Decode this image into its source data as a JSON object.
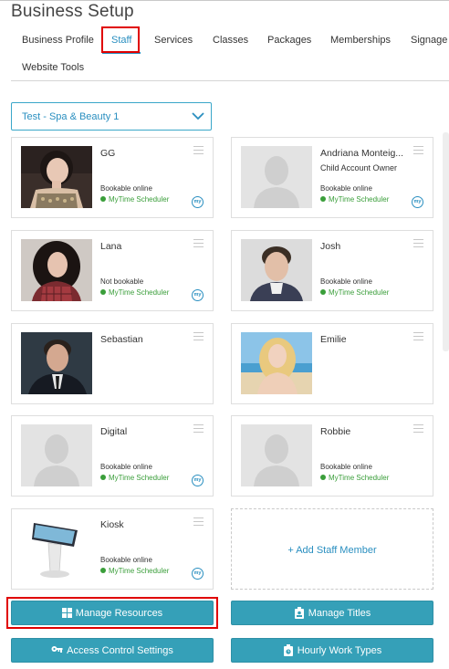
{
  "page": {
    "title": "Business Setup"
  },
  "tabs": [
    {
      "label": "Business Profile"
    },
    {
      "label": "Staff",
      "active": true
    },
    {
      "label": "Services"
    },
    {
      "label": "Classes"
    },
    {
      "label": "Packages"
    },
    {
      "label": "Memberships"
    },
    {
      "label": "Signage"
    },
    {
      "label": "Website Tools"
    }
  ],
  "location_select": {
    "value": "Test - Spa & Beauty 1"
  },
  "staff": [
    {
      "name": "GG",
      "subrole": "",
      "booking": "Bookable online",
      "scheduler": "MyTime Scheduler",
      "logo": "my",
      "photo": "woman-dark-bob"
    },
    {
      "name": "Andriana Monteig...",
      "subrole": "Child Account Owner",
      "booking": "Bookable online",
      "scheduler": "MyTime Scheduler",
      "logo": "my",
      "photo": "placeholder"
    },
    {
      "name": "Lana",
      "subrole": "",
      "booking": "Not bookable",
      "scheduler": "MyTime Scheduler",
      "logo": "my",
      "photo": "woman-curly-hair"
    },
    {
      "name": "Josh",
      "subrole": "",
      "booking": "Bookable online",
      "scheduler": "MyTime Scheduler",
      "logo": "",
      "photo": "man-short-hair"
    },
    {
      "name": "Sebastian",
      "subrole": "",
      "booking": "",
      "scheduler": "",
      "logo": "",
      "photo": "man-suit"
    },
    {
      "name": "Emilie",
      "subrole": "",
      "booking": "",
      "scheduler": "",
      "logo": "",
      "photo": "woman-blonde-beach"
    },
    {
      "name": "Digital",
      "subrole": "",
      "booking": "Bookable online",
      "scheduler": "MyTime Scheduler",
      "logo": "my",
      "photo": "placeholder"
    },
    {
      "name": "Robbie",
      "subrole": "",
      "booking": "Bookable online",
      "scheduler": "MyTime Scheduler",
      "logo": "",
      "photo": "placeholder"
    },
    {
      "name": "Kiosk",
      "subrole": "",
      "booking": "Bookable online",
      "scheduler": "MyTime Scheduler",
      "logo": "my",
      "photo": "kiosk-device"
    }
  ],
  "add_staff": {
    "label": "+ Add Staff Member"
  },
  "buttons": {
    "manage_resources": "Manage Resources",
    "manage_titles": "Manage Titles",
    "access_control": "Access Control Settings",
    "hourly_work_types": "Hourly Work Types"
  },
  "colors": {
    "accent": "#2a8fc0",
    "button": "#35a0b8",
    "status_green": "#3a9e3a",
    "highlight": "#e00000"
  }
}
